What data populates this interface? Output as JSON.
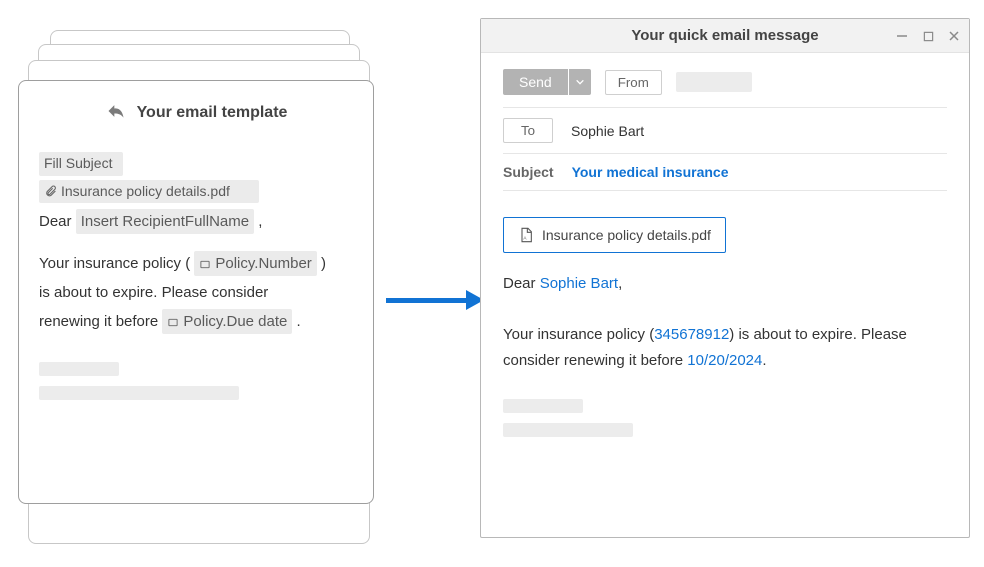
{
  "template": {
    "title": "Your email template",
    "subject_placeholder": "Fill Subject",
    "attachment": "Insurance policy details.pdf",
    "greeting_prefix": "Dear",
    "recipient_placeholder": "Insert RecipientFullName",
    "body_part1": "Your insurance policy (",
    "policy_number_field": "Policy.Number",
    "body_part2": ")",
    "body_part3": "is about to expire. Please consider",
    "body_part4": "renewing it before",
    "policy_due_field": "Policy.Due date",
    "body_end": "."
  },
  "compose": {
    "window_title": "Your quick email message",
    "send_label": "Send",
    "from_label": "From",
    "to_label": "To",
    "to_value": "Sophie Bart",
    "subject_label": "Subject",
    "subject_value": "Your medical insurance",
    "attachment": "Insurance policy details.pdf",
    "greeting_prefix": "Dear ",
    "recipient_name": "Sophie Bart",
    "greeting_suffix": ",",
    "body_prefix": "Your insurance policy (",
    "policy_number": "345678912",
    "body_mid": ") is about to expire. Please consider renewing it before ",
    "due_date": "10/20/2024",
    "body_suffix": "."
  }
}
